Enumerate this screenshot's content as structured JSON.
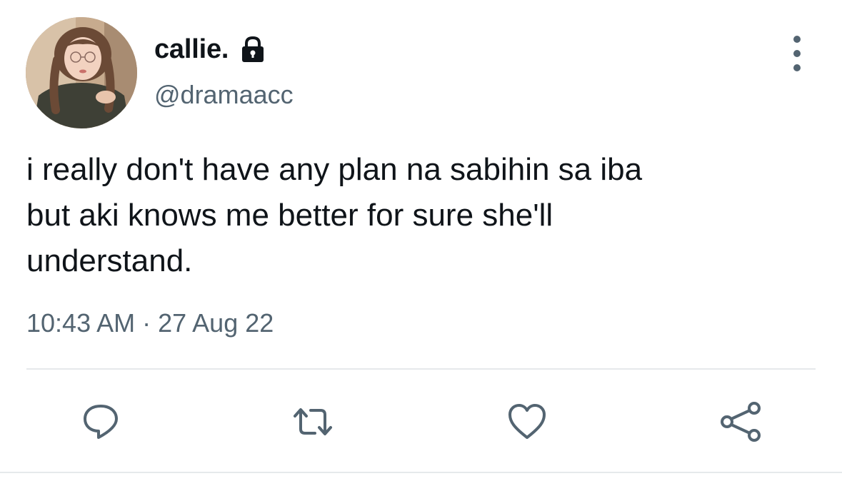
{
  "user": {
    "display_name": "callie.",
    "handle": "@dramaacc",
    "avatar_icon": "profile-photo",
    "protected_icon": "lock-icon"
  },
  "tweet": {
    "text": "i really don't have any plan na sabihin sa iba\nbut aki knows me better for sure she'll\nunderstand.",
    "timestamp": "10:43 AM · 27 Aug 22"
  },
  "actions": [
    {
      "name": "reply",
      "icon": "reply-icon"
    },
    {
      "name": "retweet",
      "icon": "retweet-icon"
    },
    {
      "name": "like",
      "icon": "heart-icon"
    },
    {
      "name": "share",
      "icon": "share-icon"
    }
  ],
  "menu": {
    "icon": "more-vertical-icon"
  },
  "colors": {
    "text_primary": "#0f1419",
    "text_secondary": "#536471",
    "divider": "#e6e9eb",
    "background": "#ffffff"
  }
}
